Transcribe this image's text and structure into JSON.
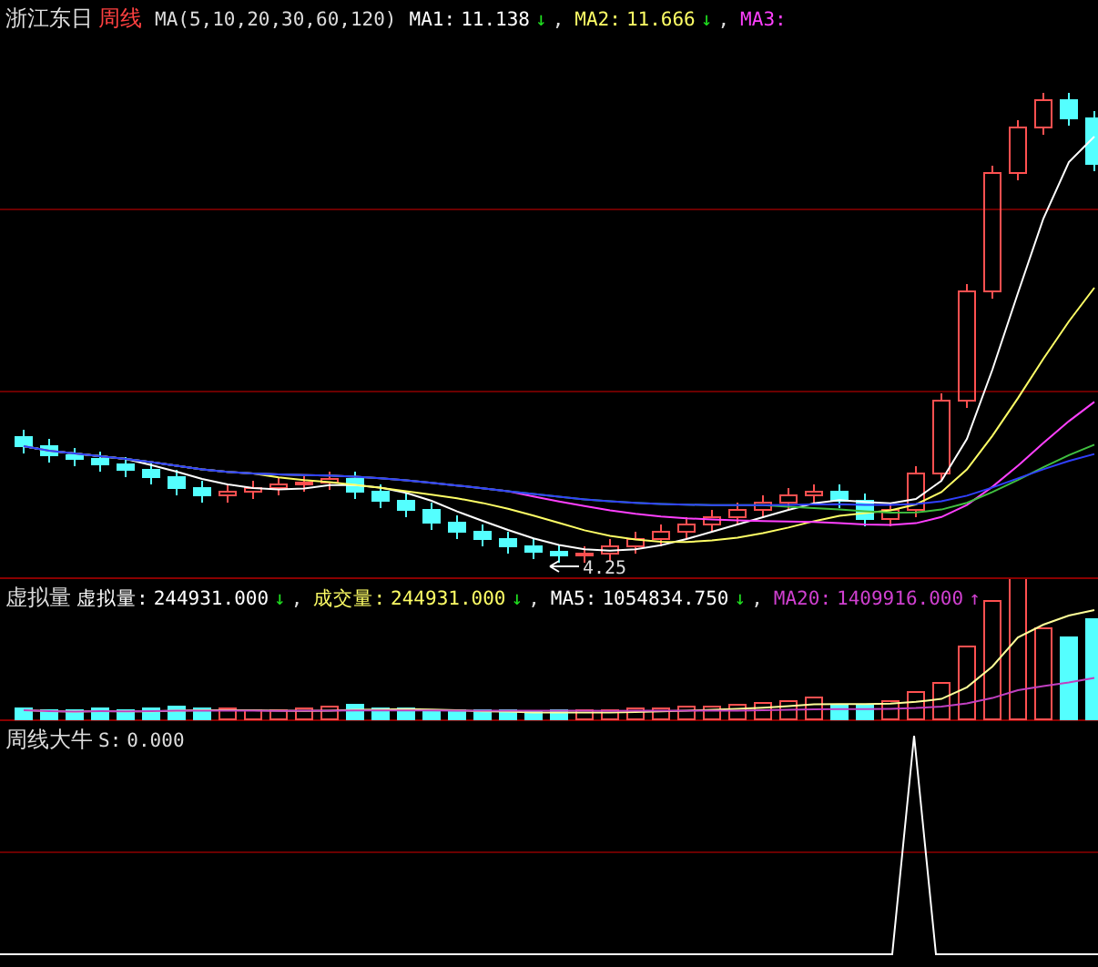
{
  "price_panel": {
    "stock_name": "浙江东日",
    "period": "周线",
    "indicator": "MA(5,10,20,30,60,120)",
    "separator": ",",
    "legend": [
      {
        "kind": "falling",
        "label": "MA1:",
        "value": "11.138",
        "arrow": "↓",
        "color": "#ffffff"
      },
      {
        "kind": "falling",
        "label": "MA2:",
        "value": "11.666",
        "arrow": "↓",
        "color": "#ffff66"
      },
      {
        "label": "MA3:",
        "color": "#ff40ff"
      }
    ],
    "low_marker": "4.25"
  },
  "volume_panel": {
    "title": "虚拟量",
    "separator": ",",
    "legend": [
      {
        "kind": "falling",
        "label": "虚拟量:",
        "value": "244931.000",
        "arrow": "↓",
        "color": "#ffffff"
      },
      {
        "kind": "falling",
        "label": "成交量:",
        "value": "244931.000",
        "arrow": "↓",
        "color": "#ffff66"
      },
      {
        "kind": "falling",
        "label": "MA5:",
        "value": "1054834.750",
        "arrow": "↓",
        "color": "#ffffff"
      },
      {
        "kind": "rising",
        "label": "MA20:",
        "value": "1409916.000",
        "arrow": "↑",
        "color": "#d040d0"
      }
    ]
  },
  "signal_panel": {
    "title": "周线大牛",
    "label": "S:",
    "value": "0.000"
  }
}
